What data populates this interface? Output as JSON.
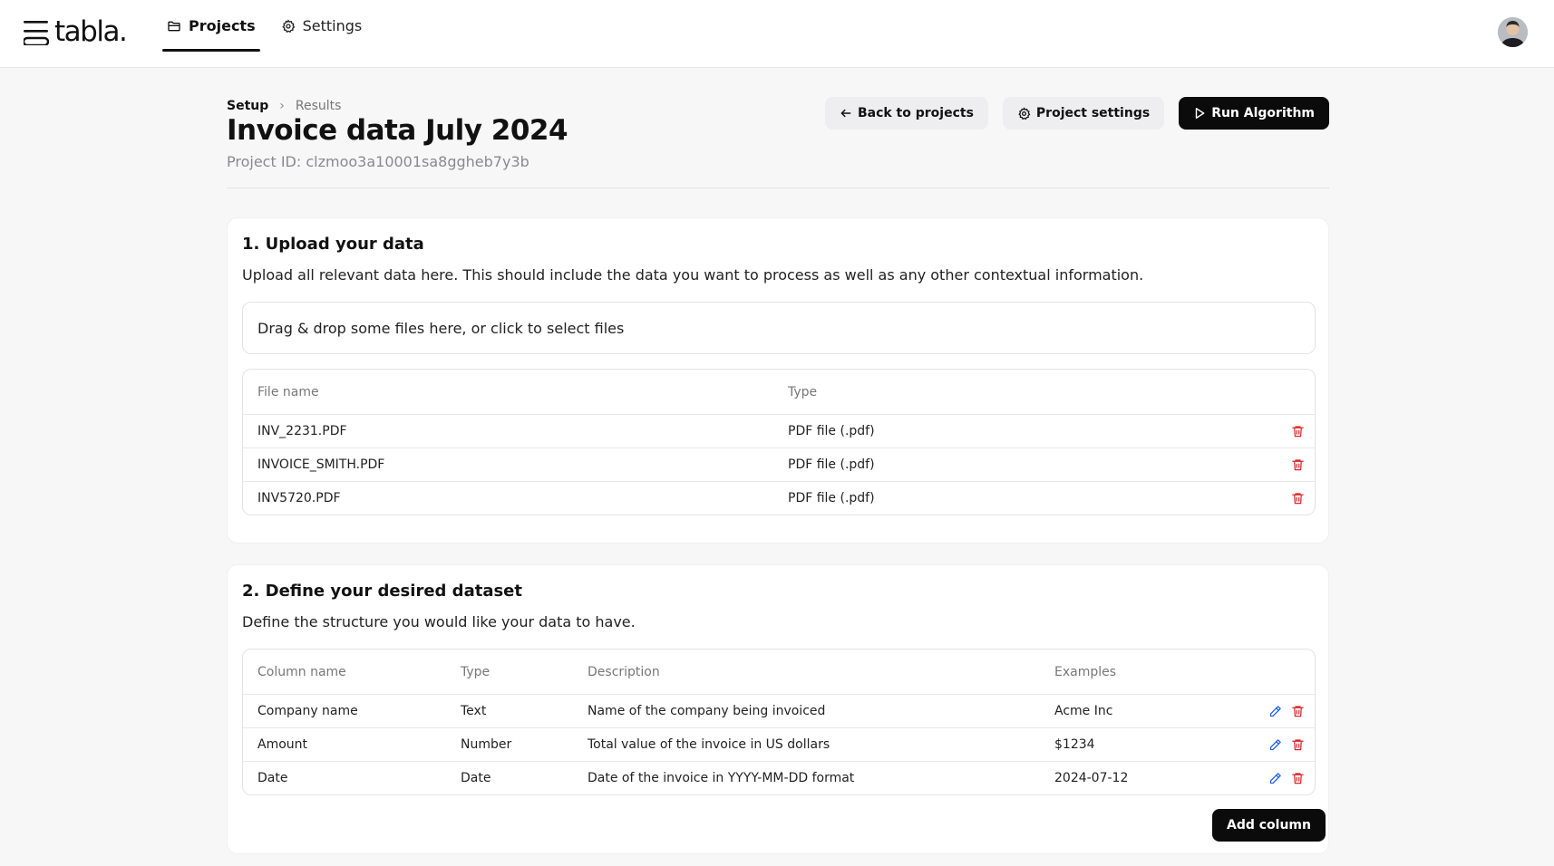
{
  "app": {
    "logo_text": "tabla."
  },
  "nav": [
    {
      "label": "Projects",
      "icon": "folder-icon",
      "active": true
    },
    {
      "label": "Settings",
      "icon": "gear-icon",
      "active": false
    }
  ],
  "breadcrumb": {
    "setup": "Setup",
    "results": "Results"
  },
  "page": {
    "title": "Invoice data July 2024",
    "project_id": "Project ID: clzmoo3a10001sa8ggheb7y3b"
  },
  "actions": {
    "back": "Back to projects",
    "settings": "Project settings",
    "run": "Run Algorithm"
  },
  "upload": {
    "title": "1. Upload your data",
    "description": "Upload all relevant data here. This should include the data you want to process as well as any other contextual information.",
    "dropzone": "Drag & drop some files here, or click to select files",
    "headers": {
      "name": "File name",
      "type": "Type"
    },
    "files": [
      {
        "name": "INV_2231.PDF",
        "type": "PDF file (.pdf)"
      },
      {
        "name": "INVOICE_SMITH.PDF",
        "type": "PDF file (.pdf)"
      },
      {
        "name": "INV5720.PDF",
        "type": "PDF file (.pdf)"
      }
    ]
  },
  "dataset": {
    "title": "2. Define your desired dataset",
    "description": "Define the structure you would like your data to have.",
    "headers": {
      "column": "Column name",
      "type": "Type",
      "description": "Description",
      "examples": "Examples"
    },
    "columns": [
      {
        "name": "Company name",
        "type": "Text",
        "description": "Name of the company being invoiced",
        "example": "Acme Inc"
      },
      {
        "name": "Amount",
        "type": "Number",
        "description": "Total value of the invoice in US dollars",
        "example": "$1234"
      },
      {
        "name": "Date",
        "type": "Date",
        "description": "Date of the invoice in YYYY-MM-DD format",
        "example": "2024-07-12"
      }
    ],
    "add_column": "Add column"
  },
  "colors": {
    "delete": "#dc2626",
    "edit": "#2563eb",
    "primary": "#0b0b0c"
  }
}
